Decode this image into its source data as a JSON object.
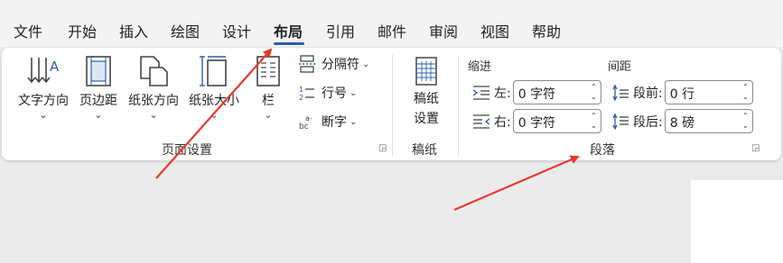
{
  "menu": {
    "tabs": [
      {
        "label": "文件"
      },
      {
        "label": "开始"
      },
      {
        "label": "插入"
      },
      {
        "label": "绘图"
      },
      {
        "label": "设计"
      },
      {
        "label": "布局"
      },
      {
        "label": "引用"
      },
      {
        "label": "邮件"
      },
      {
        "label": "审阅"
      },
      {
        "label": "视图"
      },
      {
        "label": "帮助"
      }
    ],
    "active_tab": "布局"
  },
  "page_setup": {
    "text_direction": "文字方向",
    "margins": "页边距",
    "orientation": "纸张方向",
    "size": "纸张大小",
    "columns": "栏",
    "breaks": "分隔符",
    "line_numbers": "行号",
    "hyphenation": "断字",
    "group_label": "页面设置"
  },
  "manuscript": {
    "settings_line1": "稿纸",
    "settings_line2": "设置",
    "group_label": "稿纸"
  },
  "paragraph": {
    "indent_header": "缩进",
    "spacing_header": "间距",
    "left_label": "左:",
    "left_value": "0 字符",
    "right_label": "右:",
    "right_value": "0 字符",
    "before_label": "段前:",
    "before_value": "0 行",
    "after_label": "段后:",
    "after_value": "8 磅",
    "group_label": "段落"
  },
  "colors": {
    "accent": "#2b5faf",
    "annotation_arrow": "#e8392f",
    "ribbon_bg": "#ffffff",
    "app_bg": "#ebebeb"
  }
}
